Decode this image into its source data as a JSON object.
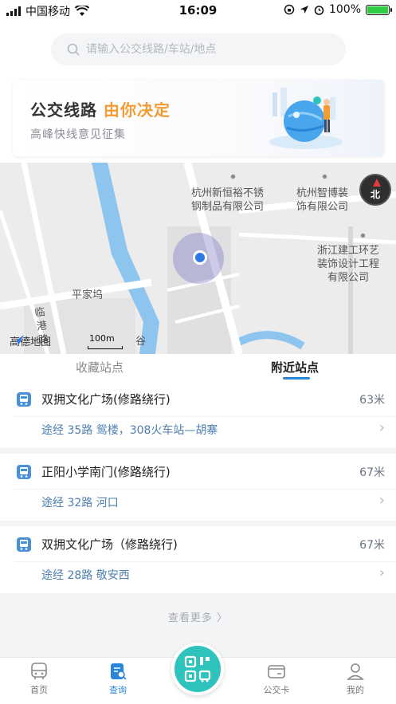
{
  "status_bar": {
    "carrier": "中国移动",
    "time": "16:09",
    "battery": "100%",
    "battery_level": 1.0
  },
  "search": {
    "placeholder": "请输入公交线路/车站/地点"
  },
  "banner": {
    "title": "公交线路",
    "title_accent": "由你决定",
    "subtitle": "高峰快线意见征集"
  },
  "map": {
    "labels": {
      "poi1": "杭州新恒裕不锈\n钢制品有限公司",
      "poi2": "杭州智博装\n饰有限公司",
      "poi3": "浙江建工环艺\n装饰设计工程\n有限公司",
      "village": "平家坞",
      "road": "临\n港\n路",
      "valley": "谷"
    },
    "compass": "北",
    "logo": "高德地图",
    "scale": "100m"
  },
  "tabs": {
    "favorites": "收藏站点",
    "nearby": "附近站点"
  },
  "stations": [
    {
      "name": "双拥文化广场(修路绕行)",
      "distance": "63米",
      "routes": "途经 35路 鸳楼，308火车站—胡寨"
    },
    {
      "name": "正阳小学南门(修路绕行)",
      "distance": "67米",
      "routes": "途经 32路 河口"
    },
    {
      "name": "双拥文化广场（修路绕行)",
      "distance": "67米",
      "routes": "途经 28路 敬安西"
    }
  ],
  "more": "查看更多 〉",
  "nav": {
    "home": "首页",
    "query": "查询",
    "card": "公交卡",
    "mine": "我的"
  },
  "colors": {
    "accent": "#2a86d9",
    "orange": "#f39b35",
    "qr": "#2fc3be"
  }
}
